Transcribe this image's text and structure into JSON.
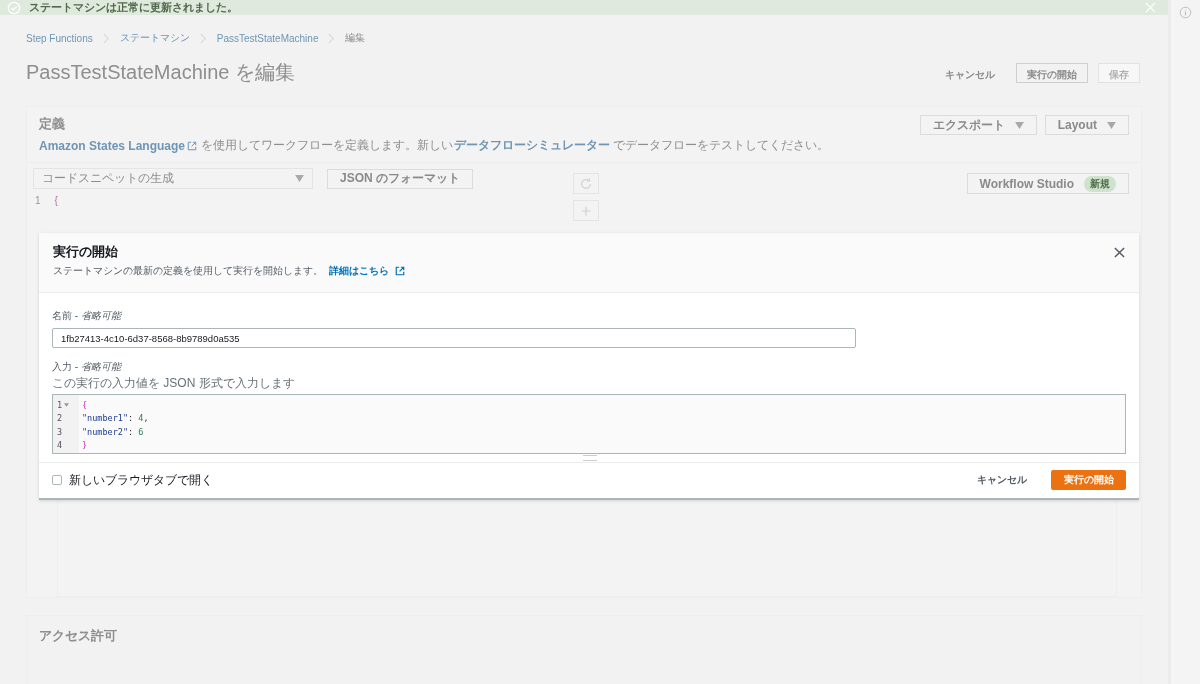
{
  "flash": {
    "message": "ステートマシンは正常に更新されました。"
  },
  "breadcrumbs": [
    {
      "label": "Step Functions",
      "link": true
    },
    {
      "label": "ステートマシン",
      "link": true
    },
    {
      "label": "PassTestStateMachine",
      "link": true
    },
    {
      "label": "編集",
      "link": false
    }
  ],
  "page_title": "PassTestStateMachine を編集",
  "header_actions": [
    {
      "label": "キャンセル",
      "kind": "link",
      "disabled": false
    },
    {
      "label": "実行の開始",
      "kind": "normal",
      "disabled": false
    },
    {
      "label": "保存",
      "kind": "primary",
      "disabled": true
    }
  ],
  "definition": {
    "title": "定義",
    "description": [
      {
        "kind": "link",
        "text": "Amazon States Language",
        "external": true
      },
      {
        "kind": "text",
        "text": "を使用してワークフローを定義します。新しい"
      },
      {
        "kind": "link",
        "text": "データフローシミュレーター",
        "external": false
      },
      {
        "kind": "text",
        "text": "でデータフローをテストしてください。"
      }
    ],
    "buttons": [
      {
        "label": "エクスポート"
      },
      {
        "label": "Layout"
      }
    ],
    "snippet_select": {
      "placeholder": "コードスニペットの生成"
    },
    "format_button": "JSON のフォーマット",
    "editor_lines": [
      {
        "number": "1",
        "text": "{"
      }
    ],
    "workflow_studio": {
      "label": "Workflow Studio",
      "badge": "新規"
    }
  },
  "access_section": {
    "title": "アクセス許可"
  },
  "modal": {
    "title": "実行の開始",
    "subtitle": "ステートマシンの最新の定義を使用して実行を開始します。",
    "learn_more": "詳細はこちら",
    "name_label": "名前 - *省略可能*",
    "name_value": "1fb27413-4c10-6d37-8568-8b9789d0a535",
    "input_label": "入力 - *省略可能*",
    "input_hint": "この実行の入力値を JSON 形式で入力します",
    "code_lines": [
      {
        "number": "1",
        "fold": true,
        "tokens": [
          {
            "kind": "brace",
            "text": "{"
          }
        ]
      },
      {
        "number": "2",
        "fold": false,
        "tokens": [
          {
            "kind": "key",
            "text": "\"number1\""
          },
          {
            "kind": "punct",
            "text": ": "
          },
          {
            "kind": "number",
            "text": "4"
          },
          {
            "kind": "punct",
            "text": ","
          }
        ]
      },
      {
        "number": "3",
        "fold": false,
        "tokens": [
          {
            "kind": "key",
            "text": "\"number2\""
          },
          {
            "kind": "punct",
            "text": ": "
          },
          {
            "kind": "number",
            "text": "6"
          }
        ]
      },
      {
        "number": "4",
        "fold": false,
        "tokens": [
          {
            "kind": "brace",
            "text": "}"
          }
        ]
      }
    ],
    "new_tab": {
      "label": "新しいブラウザタブで開く",
      "checked": false
    },
    "cancel": "キャンセル",
    "start": "実行の開始"
  }
}
